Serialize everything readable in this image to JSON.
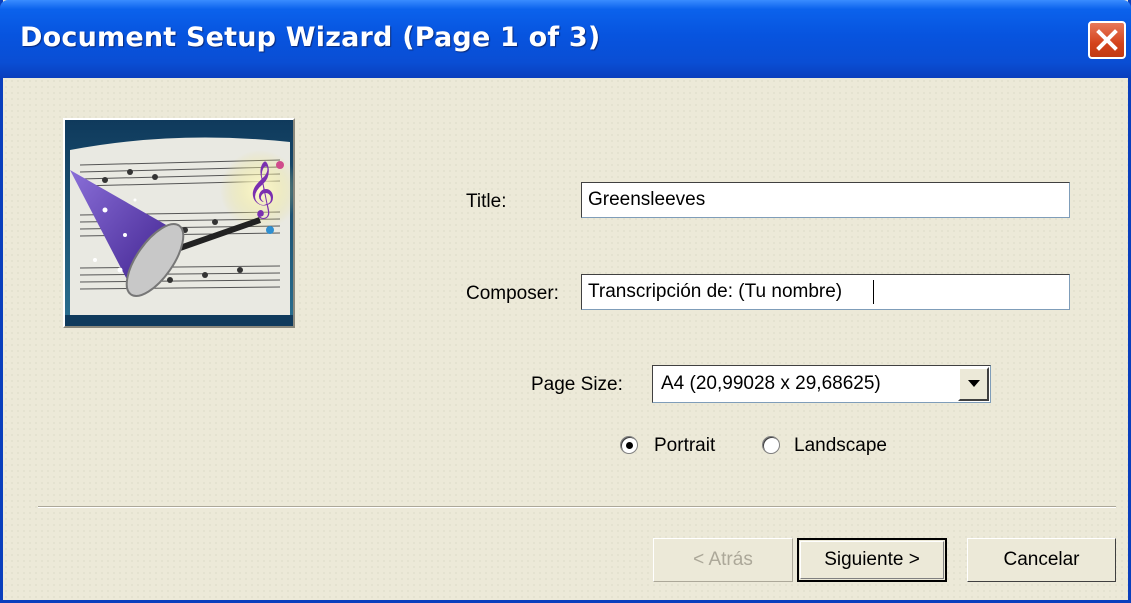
{
  "window": {
    "title": "Document Setup Wizard (Page 1 of 3)"
  },
  "form": {
    "title_label": "Title:",
    "title_value": "Greensleeves",
    "composer_label": "Composer:",
    "composer_value": "Transcripción de: (Tu nombre)",
    "page_size_label": "Page Size:",
    "page_size_value": "A4 (20,99028 x 29,68625)",
    "orientation": {
      "portrait_label": "Portrait",
      "landscape_label": "Landscape",
      "selected": "Portrait"
    }
  },
  "buttons": {
    "back_label": "< Atrás",
    "next_label": "Siguiente >",
    "cancel_label": "Cancelar"
  },
  "icons": [
    "close-icon",
    "wizard-hat-music-image",
    "dropdown-arrow-icon"
  ],
  "colors": {
    "titlebar": "#0a4ed4",
    "close_button": "#d4431c",
    "dialog_bg": "#ece9d8"
  }
}
